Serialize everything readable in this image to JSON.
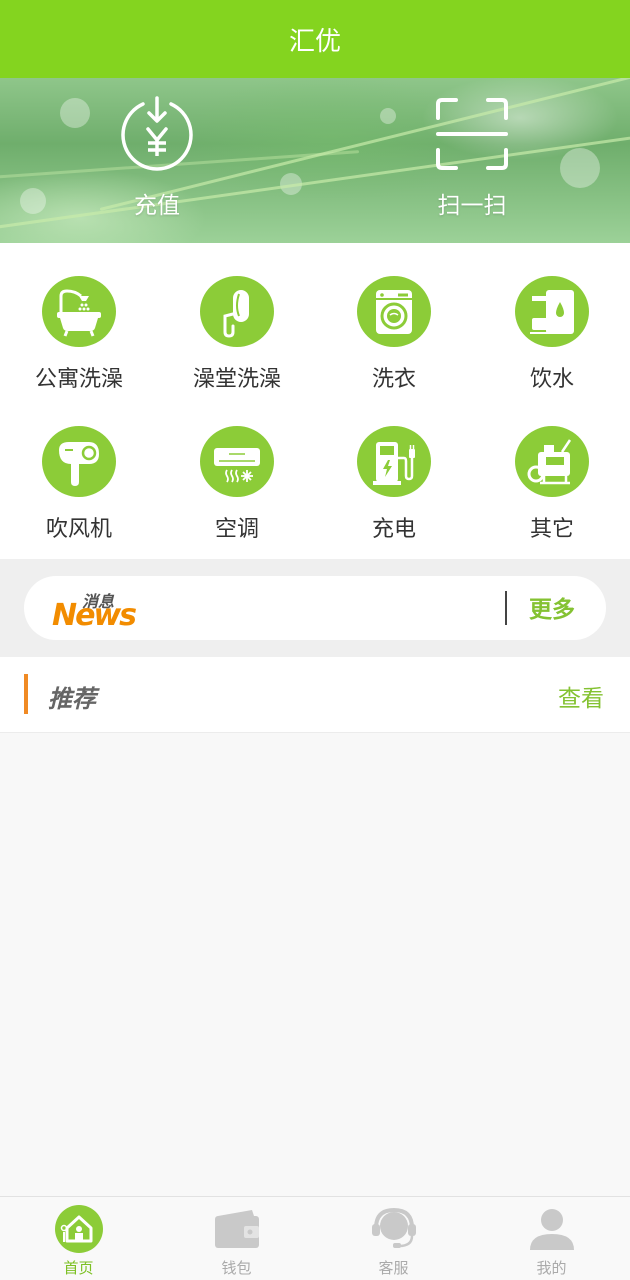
{
  "header": {
    "title": "汇优"
  },
  "banner": {
    "actions": [
      {
        "label": "充值",
        "icon": "recharge-yen-icon"
      },
      {
        "label": "扫一扫",
        "icon": "scan-frame-icon"
      }
    ]
  },
  "services": [
    {
      "label": "公寓洗澡",
      "icon": "bathtub-icon"
    },
    {
      "label": "澡堂洗澡",
      "icon": "shower-head-icon"
    },
    {
      "label": "洗衣",
      "icon": "washing-machine-icon"
    },
    {
      "label": "饮水",
      "icon": "water-dispenser-icon"
    },
    {
      "label": "吹风机",
      "icon": "hair-dryer-icon"
    },
    {
      "label": "空调",
      "icon": "air-conditioner-icon"
    },
    {
      "label": "充电",
      "icon": "charging-station-icon"
    },
    {
      "label": "其它",
      "icon": "other-device-icon"
    }
  ],
  "news": {
    "logo_cn": "消息",
    "logo_en": "News",
    "more_label": "更多"
  },
  "recommend": {
    "title": "推荐",
    "view_label": "查看"
  },
  "tabbar": {
    "items": [
      {
        "label": "首页",
        "icon": "home-icon",
        "active": true
      },
      {
        "label": "钱包",
        "icon": "wallet-icon",
        "active": false
      },
      {
        "label": "客服",
        "icon": "headset-icon",
        "active": false
      },
      {
        "label": "我的",
        "icon": "user-icon",
        "active": false
      }
    ]
  },
  "colors": {
    "brand_green": "#84d41f",
    "icon_green": "#8ccc38",
    "accent_orange": "#f08a24",
    "link_green": "#84c232"
  }
}
